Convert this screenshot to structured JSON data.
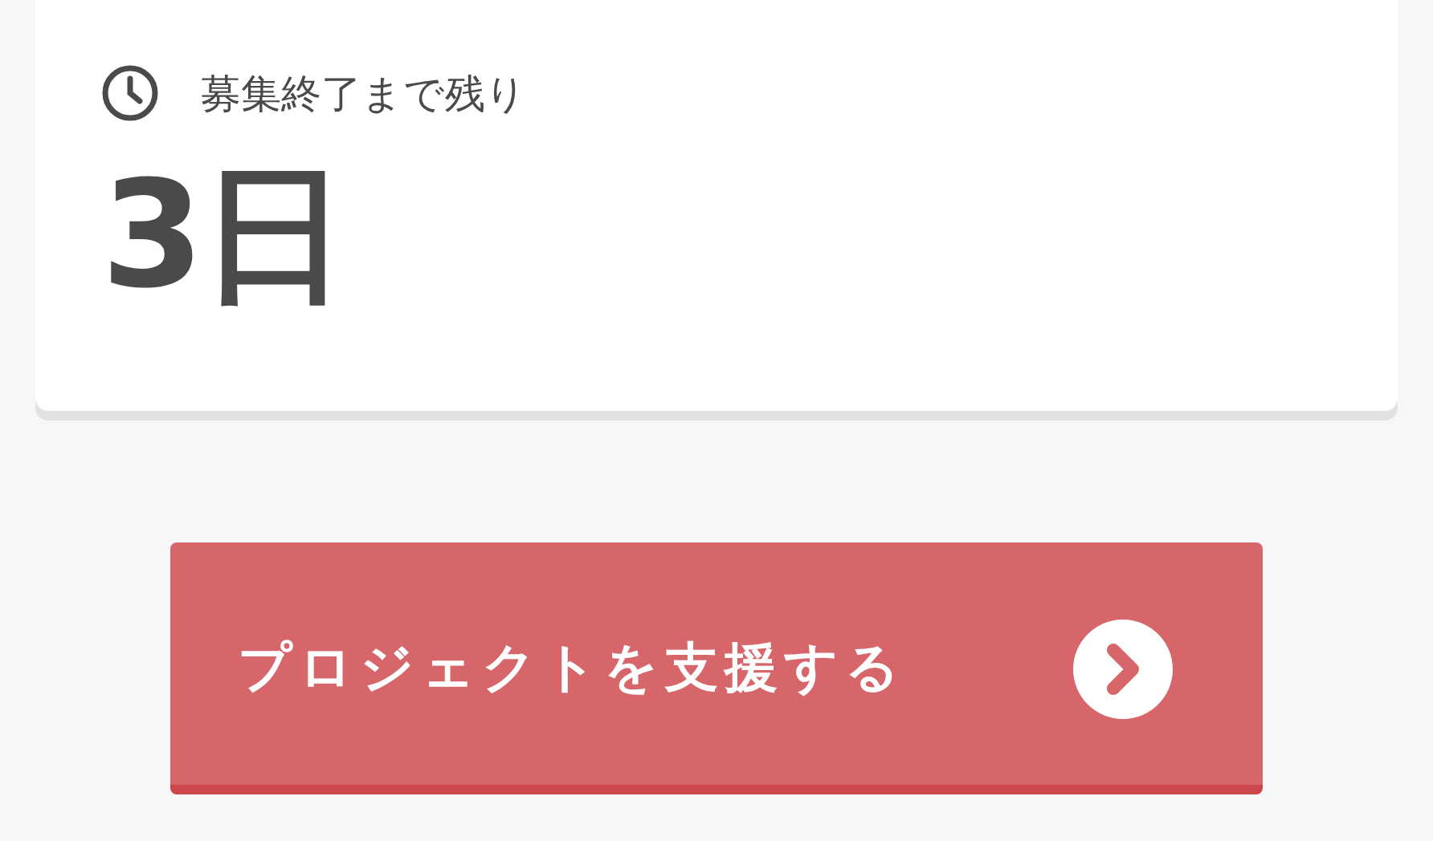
{
  "deadline": {
    "label": "募集終了まで残り",
    "value": "3日"
  },
  "support_button": {
    "label": "プロジェクトを支援する"
  }
}
